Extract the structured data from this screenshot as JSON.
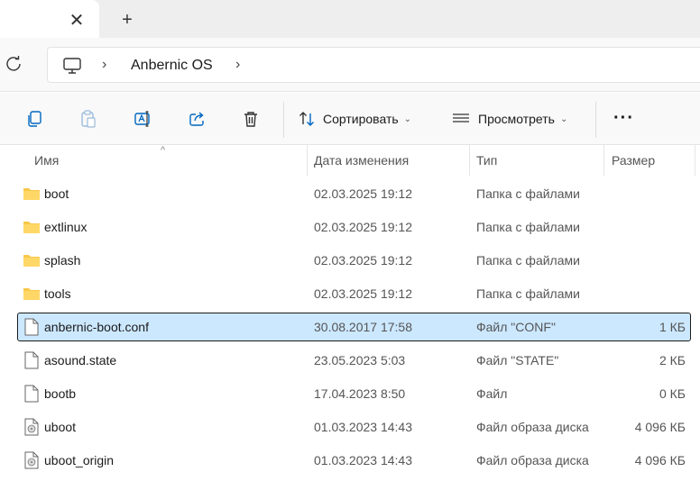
{
  "tabs": {
    "close_glyph": "✕",
    "new_tab_glyph": "+"
  },
  "address": {
    "location": "Anbernic OS",
    "separator": "›"
  },
  "toolbar": {
    "sort_label": "Сортировать",
    "view_label": "Просмотреть",
    "more_label": "···"
  },
  "columns": {
    "name": "Имя",
    "date": "Дата изменения",
    "type": "Тип",
    "size": "Размер"
  },
  "files": [
    {
      "name": "boot",
      "date": "02.03.2025 19:12",
      "type": "Папка с файлами",
      "size": "",
      "icon": "folder-icon"
    },
    {
      "name": "extlinux",
      "date": "02.03.2025 19:12",
      "type": "Папка с файлами",
      "size": "",
      "icon": "folder-icon"
    },
    {
      "name": "splash",
      "date": "02.03.2025 19:12",
      "type": "Папка с файлами",
      "size": "",
      "icon": "folder-icon"
    },
    {
      "name": "tools",
      "date": "02.03.2025 19:12",
      "type": "Папка с файлами",
      "size": "",
      "icon": "folder-icon"
    },
    {
      "name": "anbernic-boot.conf",
      "date": "30.08.2017 17:58",
      "type": "Файл \"CONF\"",
      "size": "1 КБ",
      "icon": "file-icon",
      "selected": true
    },
    {
      "name": "asound.state",
      "date": "23.05.2023 5:03",
      "type": "Файл \"STATE\"",
      "size": "2 КБ",
      "icon": "file-icon"
    },
    {
      "name": "bootb",
      "date": "17.04.2023 8:50",
      "type": "Файл",
      "size": "0 КБ",
      "icon": "file-icon"
    },
    {
      "name": "uboot",
      "date": "01.03.2023 14:43",
      "type": "Файл образа диска",
      "size": "4 096 КБ",
      "icon": "disk-image-icon"
    },
    {
      "name": "uboot_origin",
      "date": "01.03.2023 14:43",
      "type": "Файл образа диска",
      "size": "4 096 КБ",
      "icon": "disk-image-icon"
    }
  ],
  "colors": {
    "selection": "#cce8ff",
    "folder": "#f8c84a",
    "accent": "#0067c0"
  }
}
